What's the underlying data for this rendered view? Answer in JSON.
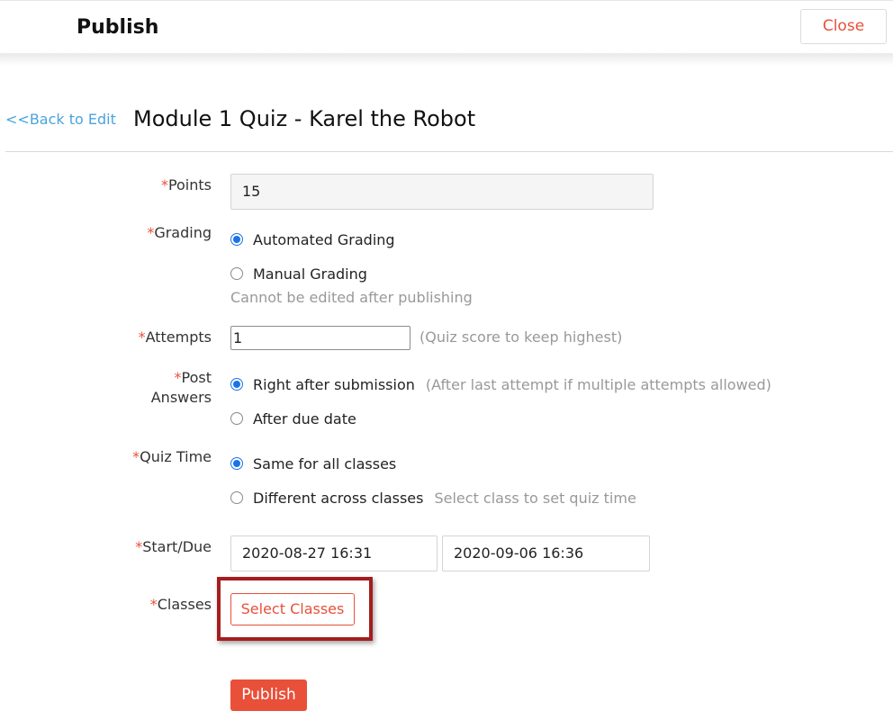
{
  "header": {
    "title": "Publish",
    "close_label": "Close"
  },
  "nav": {
    "back_label": "<<Back to Edit"
  },
  "page": {
    "title": "Module 1 Quiz - Karel the Robot"
  },
  "form": {
    "required_mark": "*",
    "points": {
      "label": "Points",
      "value": "15"
    },
    "grading": {
      "label": "Grading",
      "options": [
        "Automated Grading",
        "Manual Grading"
      ],
      "selected": "Automated Grading",
      "note": "Cannot be edited after publishing"
    },
    "attempts": {
      "label": "Attempts",
      "value": "1",
      "hint": "(Quiz score to keep highest)"
    },
    "post_answers": {
      "label_line1": "Post",
      "label_line2": "Answers",
      "options": [
        "Right after submission",
        "After due date"
      ],
      "selected": "Right after submission",
      "hint": "(After last attempt if multiple attempts allowed)"
    },
    "quiz_time": {
      "label": "Quiz Time",
      "options": [
        "Same for all classes",
        "Different across classes"
      ],
      "selected": "Same for all classes",
      "hint": "Select class to set quiz time"
    },
    "start_due": {
      "label": "Start/Due",
      "start": "2020-08-27 16:31",
      "due": "2020-09-06 16:36"
    },
    "classes": {
      "label": "Classes",
      "button_label": "Select Classes"
    },
    "publish_label": "Publish"
  },
  "colors": {
    "accent": "#e8503a",
    "link": "#4aa3df",
    "radio": "#1a73e8",
    "highlight_frame": "#a51d1d"
  }
}
